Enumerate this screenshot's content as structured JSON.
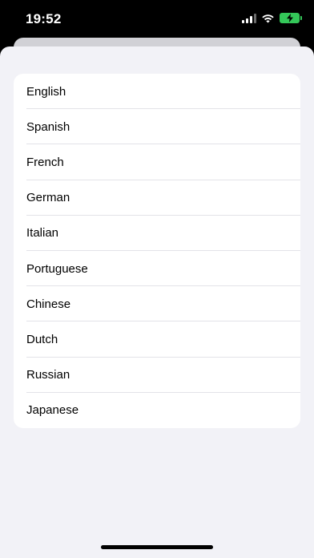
{
  "status_bar": {
    "time": "19:52"
  },
  "languages": [
    {
      "label": "English"
    },
    {
      "label": "Spanish"
    },
    {
      "label": "French"
    },
    {
      "label": "German"
    },
    {
      "label": "Italian"
    },
    {
      "label": "Portuguese"
    },
    {
      "label": "Chinese"
    },
    {
      "label": "Dutch"
    },
    {
      "label": "Russian"
    },
    {
      "label": "Japanese"
    }
  ],
  "colors": {
    "sheet_background": "#f2f2f7",
    "battery_charging": "#34c759"
  },
  "icons": [
    "cellular-signal-icon",
    "wifi-icon",
    "battery-charging-icon"
  ]
}
